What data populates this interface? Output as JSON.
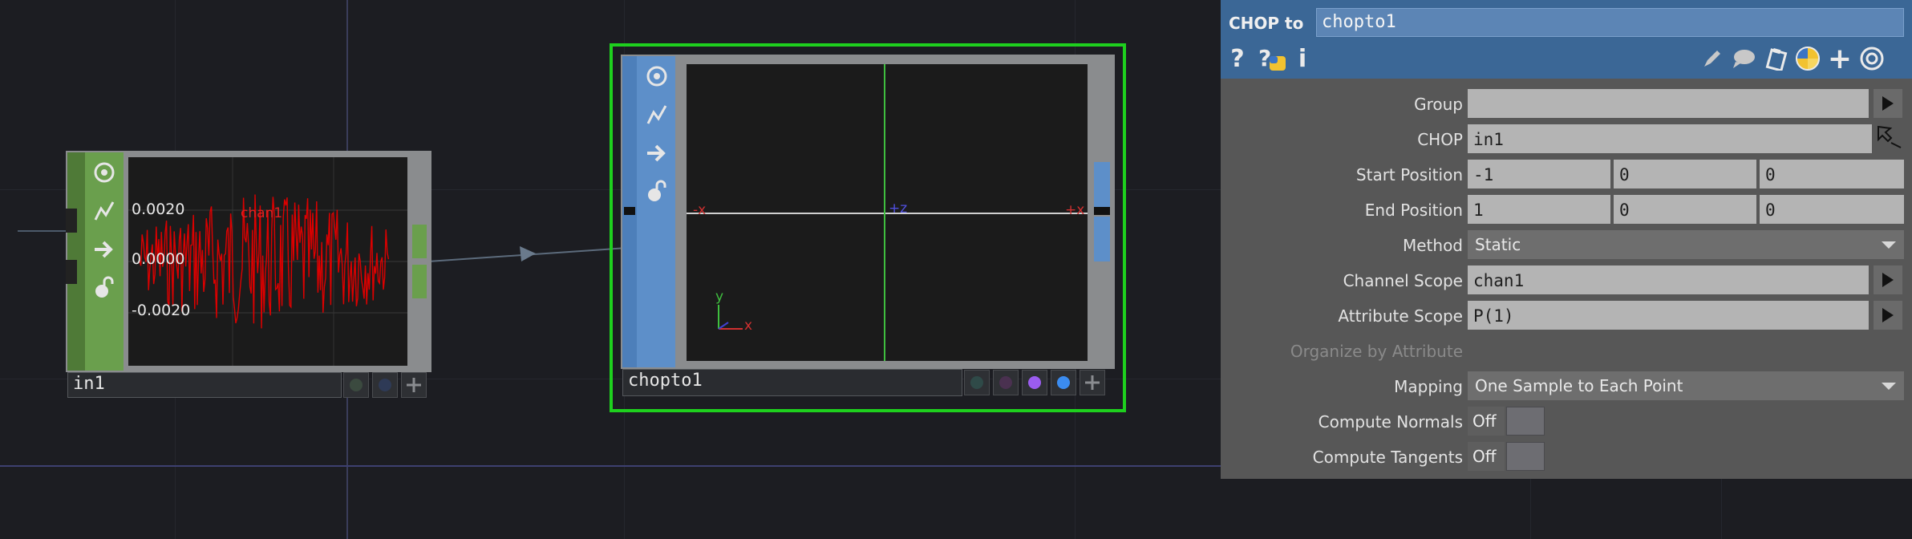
{
  "network": {
    "nodes": [
      {
        "name": "in1",
        "viewer": {
          "labels": [
            "0.0020",
            "0.0000",
            "-0.0020"
          ],
          "channel": "chan1",
          "wave_color": "#dd0000"
        },
        "bypass_icon": "bypass-icon",
        "lock_icon": "lock-icon"
      },
      {
        "name": "chopto1",
        "viewer": {
          "axis_labels": [
            "-x",
            "+z",
            "+x"
          ],
          "gizmo_labels": [
            "y",
            "x"
          ]
        },
        "selected_color": "#1ed01e"
      }
    ]
  },
  "panel": {
    "op_type": "CHOP to",
    "op_name": "chopto1",
    "header_icons": [
      "help-icon",
      "python-help-icon",
      "info-icon",
      "pencil-icon",
      "comment-icon",
      "clipboard-icon",
      "python-icon",
      "add-icon",
      "target-icon"
    ],
    "header_glyphs": {
      "help": "?",
      "info": "i",
      "add": "+"
    },
    "params": {
      "group": {
        "label": "Group",
        "value": ""
      },
      "chop": {
        "label": "CHOP",
        "value": "in1"
      },
      "start_position": {
        "label": "Start Position",
        "values": [
          "-1",
          "0",
          "0"
        ]
      },
      "end_position": {
        "label": "End Position",
        "values": [
          "1",
          "0",
          "0"
        ]
      },
      "method": {
        "label": "Method",
        "value": "Static"
      },
      "channel_scope": {
        "label": "Channel Scope",
        "value": "chan1"
      },
      "attribute_scope": {
        "label": "Attribute Scope",
        "value": "P(1)"
      },
      "organize_by_attribute": {
        "label": "Organize by Attribute"
      },
      "mapping": {
        "label": "Mapping",
        "value": "One Sample to Each Point"
      },
      "compute_normals": {
        "label": "Compute Normals",
        "value": "Off"
      },
      "compute_tangents": {
        "label": "Compute Tangents",
        "value": "Off"
      }
    }
  }
}
